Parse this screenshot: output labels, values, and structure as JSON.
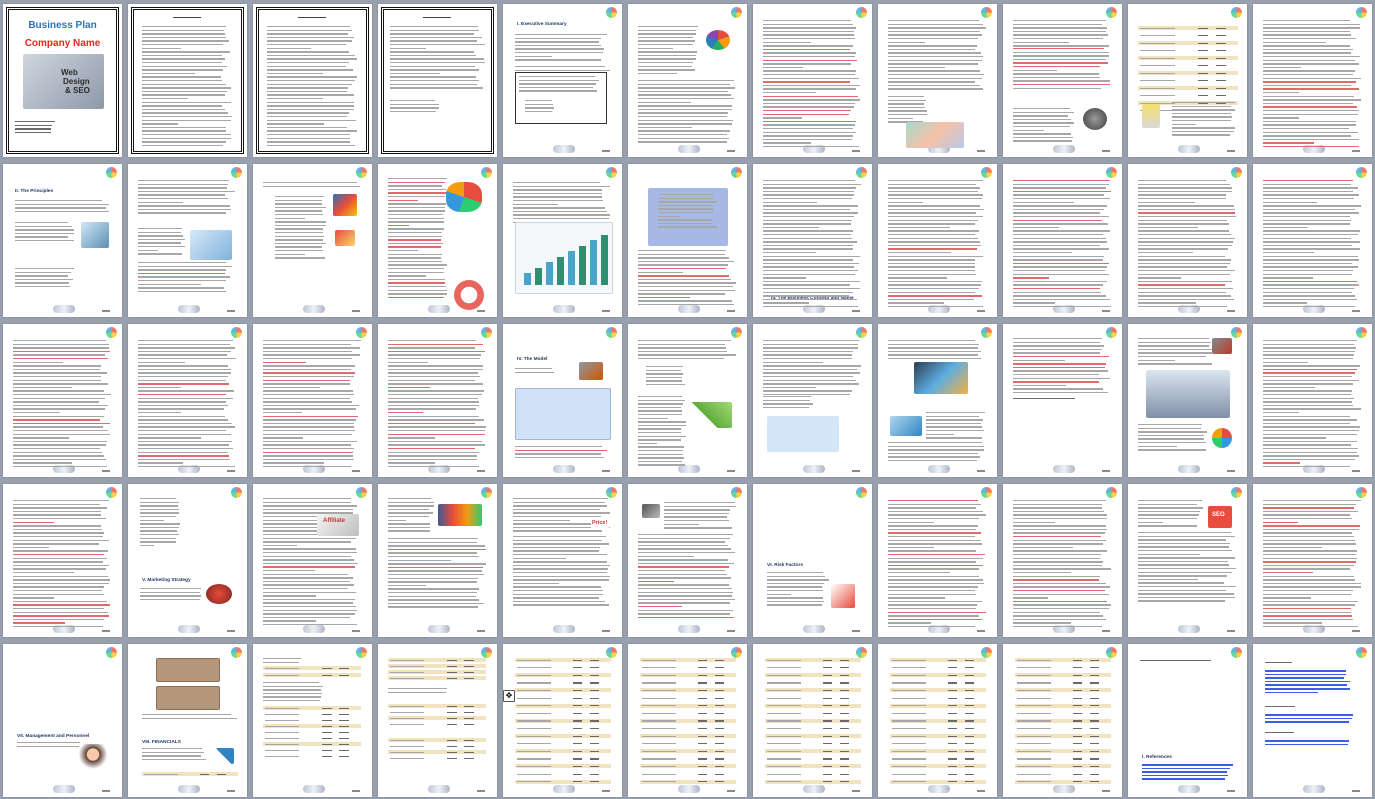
{
  "document": {
    "cover": {
      "title": "Business Plan",
      "company": "Company Name",
      "image_text_1": "Web",
      "image_text_2": "Design",
      "image_text_3": "& SEO"
    },
    "section_headings": [
      {
        "page": 5,
        "text": "I.  Executive Summary"
      },
      {
        "page": 12,
        "text": "II.  The Principles"
      },
      {
        "page": 18,
        "text": "III. The Business Concept and Name"
      },
      {
        "page": 27,
        "text": "IV. The Model"
      },
      {
        "page": 35,
        "text": "V.  Marketing Strategy"
      },
      {
        "page": 40,
        "text": "VI. Risk Factors"
      },
      {
        "page": 45,
        "text": "VII.  Management and Personnel"
      },
      {
        "page": 46,
        "text": "VIII. FINANCIALS"
      },
      {
        "page": 54,
        "text": "I.  References"
      }
    ],
    "image_labels": [
      {
        "page": 36,
        "text": "Affiliate"
      },
      {
        "page": 38,
        "text": "Price!"
      },
      {
        "page": 43,
        "text": "SEO"
      }
    ]
  },
  "colors": {
    "background": "#98a0ae",
    "page": "#ffffff",
    "cover_title": "#2e74b5",
    "cover_company": "#e8251c",
    "link_blue": "#3a5ee8",
    "highlight_red": "#e16a6a",
    "table_tan": "#f1e3c0"
  },
  "icons": [
    "corner-logo-icon",
    "footer-scroll-icon",
    "move-handle-icon"
  ]
}
